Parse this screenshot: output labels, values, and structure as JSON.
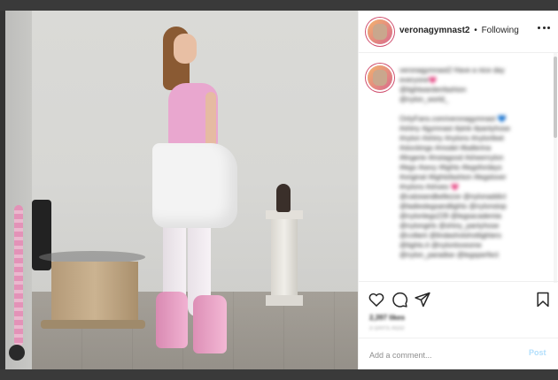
{
  "post": {
    "image_alt": "Post photo",
    "author": {
      "username": "veronagymnast2",
      "separator": "•",
      "follow_label": "Following"
    },
    "caption_lines": [
      "veronagymnast2 Have a nice day",
      "everyone💗",
      "@tightwardenfashion",
      "@nylon_world_",
      "",
      "OnlyFans.com/veronagymnast 💙",
      "#shiny #gymnast #pink #pantyhose",
      "#nylon #shiny #nylons #nylonfeet",
      "#stockings #model #ballerina",
      "#lingerie #instagood #sheernylon",
      "#legs #sexy #tights #legsfordays",
      "#original #tightsfashion #legslover",
      "#nylons #shoes 💗",
      "@calzeandbellezze @nylonaddict",
      "@ladieslegsandtights @nylonstop",
      "@nylonlegs228 @legsacademia",
      "@nylongirls @shiny_pantyhose",
      "@collant @lindashotshottighters",
      "@tights.it @nylonlovesme",
      "@nylon_paradise @legsperfect"
    ],
    "likes_text": "2,397 likes",
    "time_text": "3 DAYS AGO",
    "comment_placeholder": "Add a comment...",
    "post_label": "Post",
    "icons": [
      "heart-icon",
      "comment-icon",
      "share-icon",
      "save-icon",
      "more-icon"
    ],
    "colors": {
      "post_button": "#b2dffc",
      "text": "#262626",
      "muted": "#8e8e8e",
      "avatar_ring": "#d0506f"
    }
  }
}
